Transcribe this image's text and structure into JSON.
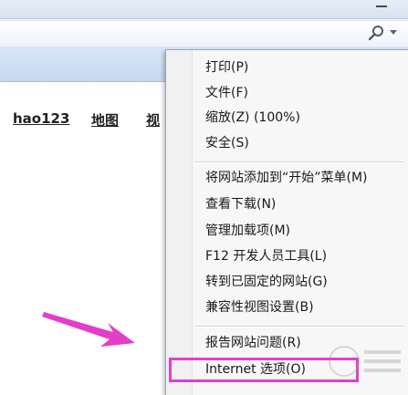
{
  "page_links": [
    {
      "label": "hao123"
    },
    {
      "label": "地图"
    },
    {
      "label": "视"
    }
  ],
  "tools_menu": {
    "items": [
      {
        "label": "打印(P)"
      },
      {
        "label": "文件(F)"
      },
      {
        "label": "缩放(Z) (100%)"
      },
      {
        "label": "安全(S)"
      },
      {
        "label": "将网站添加到“开始”菜单(M)"
      },
      {
        "label": "查看下载(N)"
      },
      {
        "label": "管理加载项(M)"
      },
      {
        "label": "F12 开发人员工具(L)"
      },
      {
        "label": "转到已固定的网站(G)"
      },
      {
        "label": "兼容性视图设置(B)"
      },
      {
        "label": "报告网站问题(R)"
      },
      {
        "label": "Internet 选项(O)"
      }
    ]
  },
  "colors": {
    "highlight": "#e43ec8",
    "arrow": "#e43ec8"
  },
  "icons": {
    "search": "search-icon",
    "dropdown": "chevron-down-icon"
  }
}
